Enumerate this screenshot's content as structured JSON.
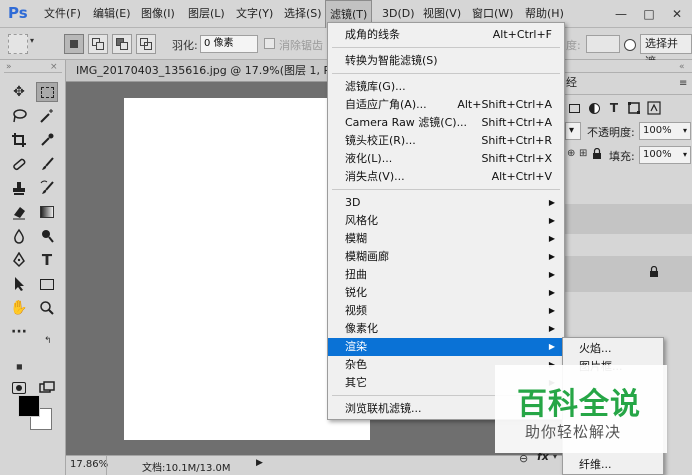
{
  "app": {
    "logo": "Ps"
  },
  "menubar": {
    "items": [
      "文件(F)",
      "编辑(E)",
      "图像(I)",
      "图层(L)",
      "文字(Y)",
      "选择(S)",
      "滤镜(T)",
      "3D(D)",
      "视图(V)",
      "窗口(W)",
      "帮助(H)"
    ],
    "active": "滤镜(T)"
  },
  "window_controls": {
    "minimize": "—",
    "maximize": "□",
    "close": "✕"
  },
  "options": {
    "feather_label": "羽化:",
    "feather_value": "0 像素",
    "antialias_label": "消除锯齿",
    "partial_label": "度:",
    "select_mask_button": "选择并遮"
  },
  "document": {
    "tab_title": "IMG_20170403_135616.jpg @ 17.9%(图层 1, RGB/8)",
    "zoom": "17.86%",
    "doc_info": "文档:10.1M/13.0M"
  },
  "right_panel": {
    "tab_label": "经",
    "opacity_label": "不透明度:",
    "opacity_value": "100%",
    "fill_label": "填充:",
    "fill_value": "100%",
    "fx_label": "fx"
  },
  "filter_menu": {
    "items": [
      {
        "label": "成角的线条",
        "shortcut": "Alt+Ctrl+F"
      },
      {
        "separator": true
      },
      {
        "label": "转换为智能滤镜(S)"
      },
      {
        "separator": true
      },
      {
        "label": "滤镜库(G)..."
      },
      {
        "label": "自适应广角(A)...",
        "shortcut": "Alt+Shift+Ctrl+A"
      },
      {
        "label": "Camera Raw 滤镜(C)...",
        "shortcut": "Shift+Ctrl+A"
      },
      {
        "label": "镜头校正(R)...",
        "shortcut": "Shift+Ctrl+R"
      },
      {
        "label": "液化(L)...",
        "shortcut": "Shift+Ctrl+X"
      },
      {
        "label": "消失点(V)...",
        "shortcut": "Alt+Ctrl+V"
      },
      {
        "separator": true
      },
      {
        "label": "3D",
        "submenu": true
      },
      {
        "label": "风格化",
        "submenu": true
      },
      {
        "label": "模糊",
        "submenu": true
      },
      {
        "label": "模糊画廊",
        "submenu": true
      },
      {
        "label": "扭曲",
        "submenu": true
      },
      {
        "label": "锐化",
        "submenu": true
      },
      {
        "label": "视频",
        "submenu": true
      },
      {
        "label": "像素化",
        "submenu": true
      },
      {
        "label": "渲染",
        "submenu": true,
        "highlighted": true
      },
      {
        "label": "杂色",
        "submenu": true
      },
      {
        "label": "其它",
        "submenu": true
      },
      {
        "separator": true
      },
      {
        "label": "浏览联机滤镜..."
      }
    ]
  },
  "render_submenu": {
    "items": [
      "火焰...",
      "图片框...",
      "纤维..."
    ]
  },
  "watermark": {
    "main": "百科全说",
    "sub": "助你轻松解决"
  }
}
